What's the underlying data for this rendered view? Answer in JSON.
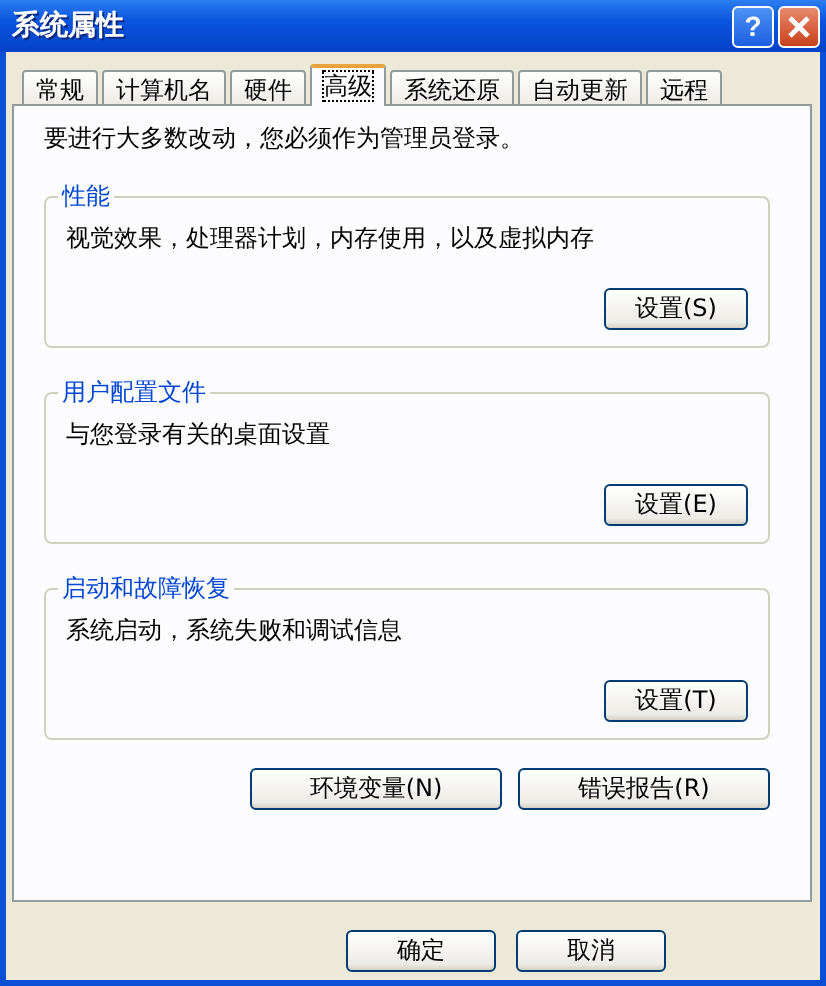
{
  "window": {
    "title": "系统属性",
    "help_button": "?"
  },
  "tabs": [
    {
      "label": "常规",
      "selected": false
    },
    {
      "label": "计算机名",
      "selected": false
    },
    {
      "label": "硬件",
      "selected": false
    },
    {
      "label": "高级",
      "selected": true
    },
    {
      "label": "系统还原",
      "selected": false
    },
    {
      "label": "自动更新",
      "selected": false
    },
    {
      "label": "远程",
      "selected": false
    }
  ],
  "notice": "要进行大多数改动，您必须作为管理员登录。",
  "groups": [
    {
      "title": "性能",
      "description": "视觉效果，处理器计划，内存使用，以及虚拟内存",
      "button": "设置(S)"
    },
    {
      "title": "用户配置文件",
      "description": "与您登录有关的桌面设置",
      "button": "设置(E)"
    },
    {
      "title": "启动和故障恢复",
      "description": "系统启动，系统失败和调试信息",
      "button": "设置(T)"
    }
  ],
  "extra_buttons": [
    "环境变量(N)",
    "错误报告(R)"
  ],
  "dialog_buttons": [
    "确定",
    "取消"
  ]
}
